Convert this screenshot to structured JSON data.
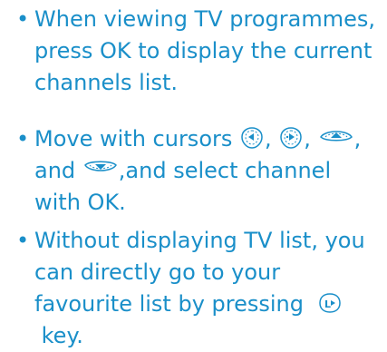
{
  "colors": {
    "text": "#1a8fc9",
    "background": "#ffffff"
  },
  "items": [
    {
      "bullet": "•",
      "text": "When viewing TV programmes, press OK to display the current channels list."
    },
    {
      "bullet": "•",
      "part1": "Move with cursors",
      "sep1": ",",
      "sep2": ",",
      "sep3": ",",
      "part2": "and",
      "part3": ",and select channel with OK.",
      "icons": [
        "cursor-left-icon",
        "cursor-right-icon",
        "cursor-up-icon",
        "cursor-down-icon"
      ]
    },
    {
      "bullet": "•",
      "part1": "Without displaying TV list, you can directly go to your favourite list by pressing",
      "part2": "key.",
      "icons": [
        "favourite-list-key-icon"
      ]
    }
  ]
}
